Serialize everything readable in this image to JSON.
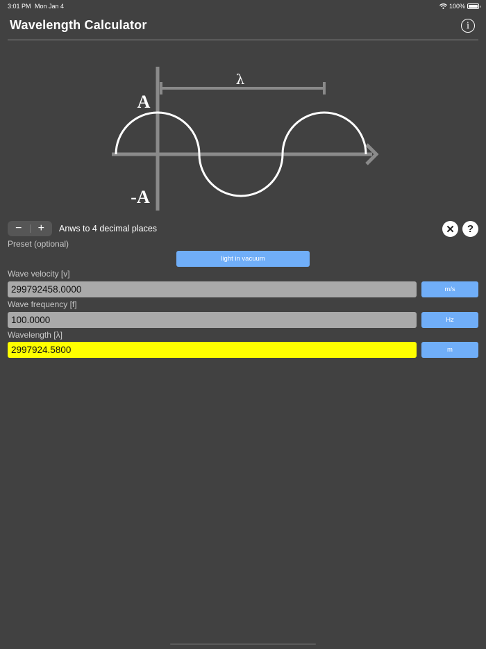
{
  "status_bar": {
    "time": "3:01 PM",
    "date": "Mon Jan 4",
    "battery": "100%"
  },
  "header": {
    "title": "Wavelength Calculator",
    "info_icon": "info-icon"
  },
  "diagram": {
    "lambda_label": "λ",
    "amplitude_label": "A",
    "neg_amplitude_label": "-A"
  },
  "precision": {
    "minus_label": "−",
    "plus_label": "+",
    "label": "Anws to 4 decimal places"
  },
  "actions": {
    "clear_icon": "close-icon",
    "clear_label": "✕",
    "help_icon": "help-icon",
    "help_label": "?"
  },
  "preset": {
    "label": "Preset (optional)",
    "button_label": "light in vacuum"
  },
  "fields": {
    "velocity": {
      "label": "Wave velocity [v]",
      "value": "299792458.0000",
      "unit": "m/s"
    },
    "frequency": {
      "label": "Wave frequency [f]",
      "value": "100.0000",
      "unit": "Hz"
    },
    "wavelength": {
      "label": "Wavelength [λ]",
      "value": "2997924.5800",
      "unit": "m"
    }
  },
  "colors": {
    "background": "#414141",
    "accent_button": "#70aef8",
    "input_background": "#a9a9a9",
    "result_highlight": "#ffff00"
  }
}
